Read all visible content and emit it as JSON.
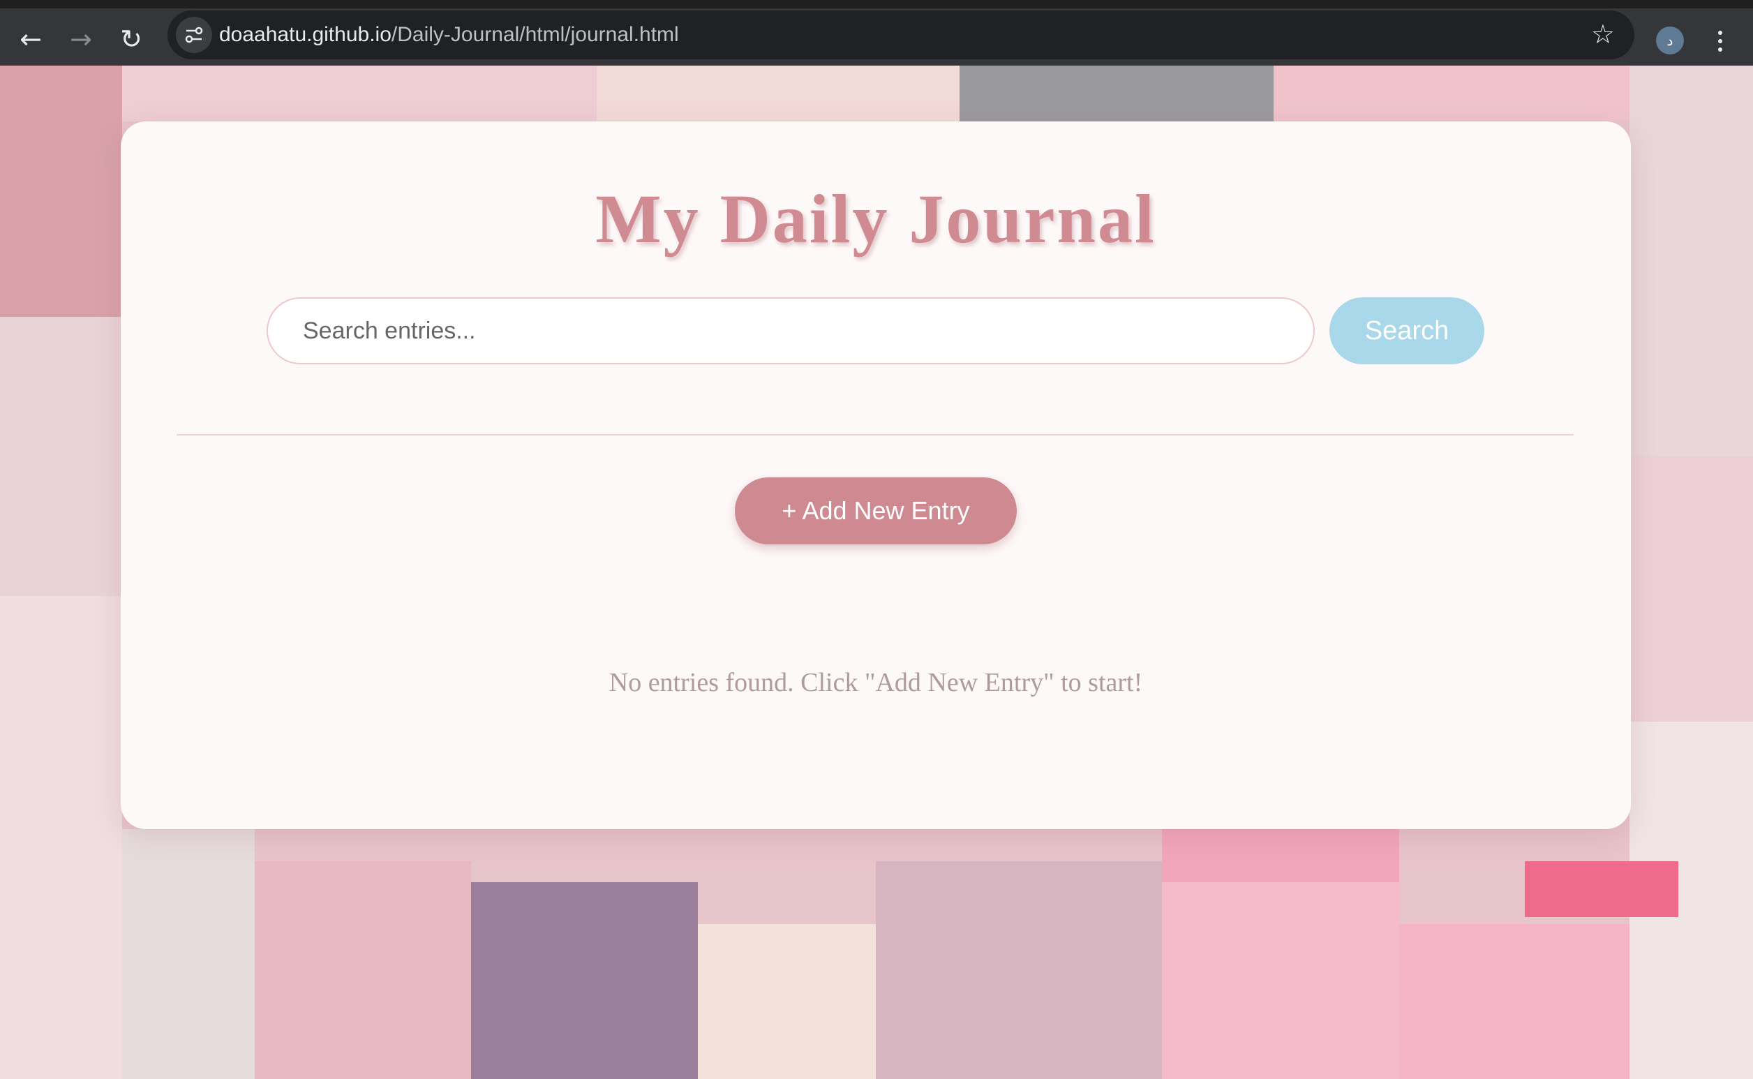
{
  "browser": {
    "url_host": "doaahatu.github.io",
    "url_path": "/Daily-Journal/html/journal.html",
    "profile_initial": "د",
    "icons": {
      "back": "back-arrow-icon",
      "forward": "forward-arrow-icon",
      "reload": "reload-icon",
      "site_info": "site-settings-icon",
      "bookmark": "star-icon",
      "menu": "kebab-menu-icon"
    }
  },
  "page": {
    "title": "My Daily Journal",
    "search": {
      "placeholder": "Search entries...",
      "value": "",
      "button_label": "Search"
    },
    "add_button_label": "+ Add New Entry",
    "empty_message": "No entries found. Click \"Add New Entry\" to start!"
  },
  "colors": {
    "title": "#d08a91",
    "search_button": "#a8d8ea",
    "add_button": "#cf8a91",
    "background_theme": "#e8c5cb"
  }
}
